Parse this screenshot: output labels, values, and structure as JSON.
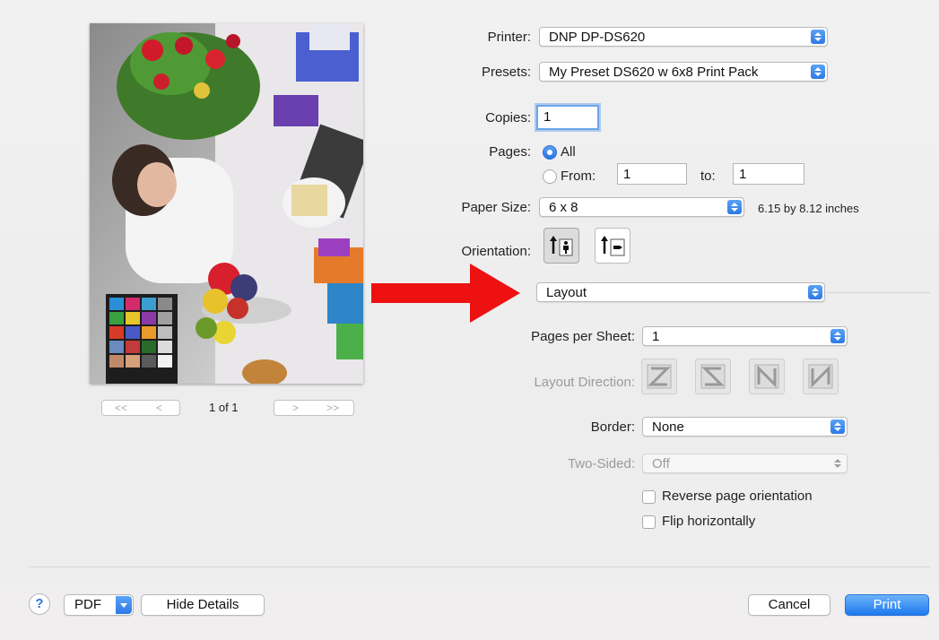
{
  "printer": {
    "label": "Printer:",
    "value": "DNP DP-DS620"
  },
  "presets": {
    "label": "Presets:",
    "value": "My Preset DS620 w 6x8 Print Pack"
  },
  "copies": {
    "label": "Copies:",
    "value": "1"
  },
  "pages": {
    "label": "Pages:",
    "all_label": "All",
    "from_label": "From:",
    "from_value": "1",
    "to_label": "to:",
    "to_value": "1"
  },
  "paper_size": {
    "label": "Paper Size:",
    "value": "6 x 8",
    "dimensions": "6.15 by 8.12 inches"
  },
  "orientation": {
    "label": "Orientation:"
  },
  "section": {
    "value": "Layout"
  },
  "layout": {
    "pages_per_sheet_label": "Pages per Sheet:",
    "pages_per_sheet_value": "1",
    "layout_direction_label": "Layout Direction:",
    "border_label": "Border:",
    "border_value": "None",
    "two_sided_label": "Two-Sided:",
    "two_sided_value": "Off",
    "reverse_label": "Reverse page orientation",
    "flip_label": "Flip horizontally"
  },
  "preview": {
    "page_indicator": "1 of 1",
    "first": "<<",
    "prev": "<",
    "next": ">",
    "last": ">>"
  },
  "footer": {
    "help": "?",
    "pdf": "PDF",
    "hide_details": "Hide Details",
    "cancel": "Cancel",
    "print": "Print"
  },
  "colors": {
    "accent": "#2d79e6",
    "arrow": "#ee1111"
  },
  "icons": [
    "portrait-orientation-icon",
    "landscape-orientation-icon",
    "z-layout-icon",
    "s-layout-icon",
    "n-reverse-layout-icon",
    "n-layout-icon",
    "red-arrow"
  ]
}
